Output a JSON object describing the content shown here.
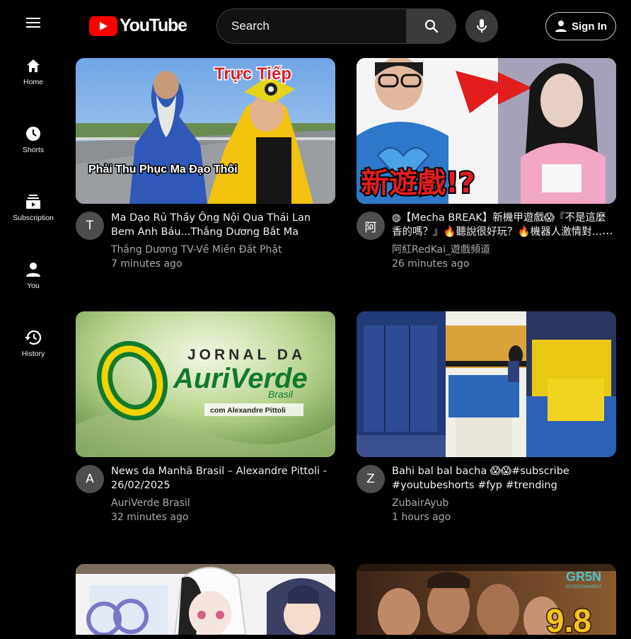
{
  "app": {
    "logo_text": "YouTube",
    "brand_color": "#ff0000"
  },
  "header": {
    "search_placeholder": "Search",
    "signin_label": "Sign In",
    "icons": [
      "menu-icon",
      "youtube-play-icon",
      "search-icon",
      "mic-icon",
      "account-icon"
    ]
  },
  "sidebar": {
    "items": [
      {
        "label": "Home",
        "icon": "home-icon"
      },
      {
        "label": "Shorts",
        "icon": "shorts-icon"
      },
      {
        "label": "Subscription",
        "icon": "subscriptions-icon"
      },
      {
        "label": "You",
        "icon": "you-icon"
      },
      {
        "label": "History",
        "icon": "history-icon"
      }
    ]
  },
  "videos": [
    {
      "avatar": "T",
      "title": "Ma Dạo Rủ Thầy Ông Nội Qua Thái Lan Bem Anh Báu...Thắng Dương Bắt Ma",
      "channel": "Thắng Dương TV-Về Miền Đất Phật",
      "age": "7 minutes ago",
      "thumb_texts": [
        "Trực Tiếp",
        "Phải Thu Phục Ma Đạo Thôi"
      ]
    },
    {
      "avatar": "阿",
      "title": "◍【Mecha BREAK】新機甲遊戲😱『不是這麼香的嗎？』🔥聽說很好玩？🔥機器人激情對戰！🤖",
      "channel": "阿紅RedKai_遊戲頻道",
      "age": "26 minutes ago",
      "thumb_texts": [
        "新遊戲!?"
      ]
    },
    {
      "avatar": "A",
      "title": "News da Manhã Brasil – Alexandre Pittoli - 26/02/2025",
      "channel": "AuriVerde Brasil",
      "age": "32 minutes ago",
      "thumb_texts": [
        "JORNAL DA",
        "AuriVerde",
        "Brasil",
        "com Alexandre Pittoli"
      ]
    },
    {
      "avatar": "Z",
      "title": "Bahi bal bal bacha 😱😱#subscribe #youtubeshorts #fyp #trending",
      "channel": "ZubairAyub",
      "age": "1 hours ago",
      "thumb_texts": []
    },
    {
      "avatar": "",
      "title": "",
      "channel": "",
      "age": "",
      "thumb_texts": []
    },
    {
      "avatar": "",
      "title": "",
      "channel": "",
      "age": "",
      "thumb_texts": [
        "GR5N",
        "ENTERTAINMENT",
        "9.8"
      ]
    }
  ]
}
